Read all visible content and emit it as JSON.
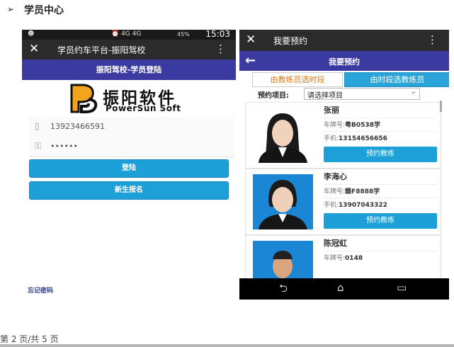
{
  "section": {
    "bullet": "➢",
    "title": "学员中心"
  },
  "left_phone": {
    "status": {
      "icons": "⏰ 4G 4G",
      "battery": "45%",
      "time": "15:03"
    },
    "app_bar": {
      "close": "✕",
      "title": "学员约车平台-振阳驾校",
      "menu": "⋮"
    },
    "banner": "振阳驾校-学员登陆",
    "logo": {
      "cn": "振阳软件",
      "en": "PowerSun Soft"
    },
    "phone_field": {
      "icon": "phone-icon",
      "value": "13923466591"
    },
    "password_field": {
      "icon": "lock-icon",
      "value": "••••••"
    },
    "login_button": "登陆",
    "register_button": "新生报名",
    "forgot_link": "忘记密码"
  },
  "right_phone": {
    "app_bar": {
      "close": "✕",
      "title": "我要预约",
      "menu": "⋮"
    },
    "header": {
      "back": "←",
      "title": "我要预约"
    },
    "tabs": [
      {
        "label": "由教练员选时段",
        "active": false
      },
      {
        "label": "由时段选教练员",
        "active": true
      }
    ],
    "project": {
      "label": "预约项目:",
      "selected": "请选择项目"
    },
    "coaches": [
      {
        "name": "张丽",
        "plate_label": "车牌号:",
        "plate": "粤B0538学",
        "phone_label": "手机:",
        "phone": "13154656656",
        "button": "预约教练"
      },
      {
        "name": "李海心",
        "plate_label": "车牌号:",
        "plate": "赣F8888学",
        "phone_label": "手机:",
        "phone": "13907043322",
        "button": "预约教练"
      },
      {
        "name": "陈冠虹",
        "plate_label": "车牌号:",
        "plate": "0148"
      }
    ],
    "nav": {
      "back": "⮌",
      "home": "⌂",
      "recent": "▭"
    }
  },
  "footer": "第 2 页/共 5 页",
  "colors": {
    "banner": "#3a3aa0",
    "button": "#1d9fd8",
    "tab_active_text": "#e07a12"
  }
}
